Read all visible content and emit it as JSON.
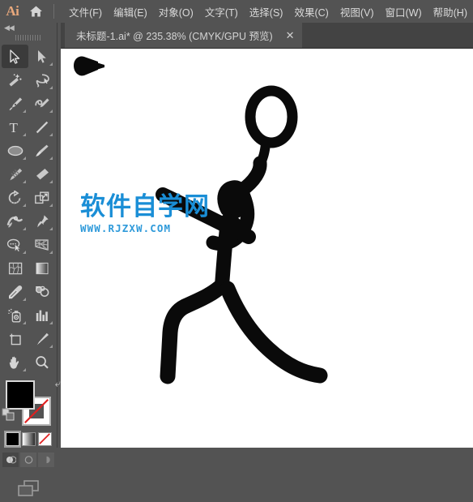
{
  "app": {
    "name": "Ai",
    "logo_color": "#e8a87c",
    "home_icon": "home-icon"
  },
  "menubar": {
    "items": [
      {
        "label": "文件(F)",
        "name": "menu-file"
      },
      {
        "label": "编辑(E)",
        "name": "menu-edit"
      },
      {
        "label": "对象(O)",
        "name": "menu-object"
      },
      {
        "label": "文字(T)",
        "name": "menu-type"
      },
      {
        "label": "选择(S)",
        "name": "menu-select"
      },
      {
        "label": "效果(C)",
        "name": "menu-effect"
      },
      {
        "label": "视图(V)",
        "name": "menu-view"
      },
      {
        "label": "窗口(W)",
        "name": "menu-window"
      },
      {
        "label": "帮助(H)",
        "name": "menu-help"
      }
    ]
  },
  "tabbar": {
    "tabs": [
      {
        "title": "未标题-1.ai* @ 235.38% (CMYK/GPU 预览)",
        "close_label": "✕",
        "active": true
      }
    ]
  },
  "toolpanel": {
    "collapse_label": "◀◀",
    "tools": [
      {
        "name": "selection-tool",
        "icon": "arrow-solid-outline",
        "active": true,
        "corner": false
      },
      {
        "name": "direct-selection-tool",
        "icon": "arrow-filled",
        "active": false,
        "corner": true
      },
      {
        "name": "magic-wand-tool",
        "icon": "magic-wand",
        "active": false,
        "corner": false
      },
      {
        "name": "lasso-tool",
        "icon": "lasso",
        "active": false,
        "corner": true
      },
      {
        "name": "pen-tool",
        "icon": "pen-nib",
        "active": false,
        "corner": true
      },
      {
        "name": "curvature-tool",
        "icon": "curvature",
        "active": false,
        "corner": true
      },
      {
        "name": "type-tool",
        "icon": "type-T",
        "active": false,
        "corner": true
      },
      {
        "name": "line-segment-tool",
        "icon": "line-diagonal",
        "active": false,
        "corner": true
      },
      {
        "name": "ellipse-tool",
        "icon": "ellipse",
        "active": false,
        "corner": true
      },
      {
        "name": "paintbrush-tool",
        "icon": "paintbrush",
        "active": false,
        "corner": true
      },
      {
        "name": "shaper-tool",
        "icon": "shaper-pencil",
        "active": false,
        "corner": true
      },
      {
        "name": "eraser-tool",
        "icon": "eraser",
        "active": false,
        "corner": true
      },
      {
        "name": "rotate-tool",
        "icon": "rotate",
        "active": false,
        "corner": true
      },
      {
        "name": "scale-tool",
        "icon": "scale-squares",
        "active": false,
        "corner": true
      },
      {
        "name": "width-tool",
        "icon": "width-warp",
        "active": false,
        "corner": true
      },
      {
        "name": "free-transform-tool",
        "icon": "push-pin",
        "active": false,
        "corner": true
      },
      {
        "name": "shape-builder-tool",
        "icon": "shape-builder",
        "active": false,
        "corner": true
      },
      {
        "name": "perspective-grid-tool",
        "icon": "perspective-grid",
        "active": false,
        "corner": true
      },
      {
        "name": "mesh-tool",
        "icon": "mesh",
        "active": false,
        "corner": false
      },
      {
        "name": "gradient-tool",
        "icon": "gradient-bar",
        "active": false,
        "corner": false
      },
      {
        "name": "eyedropper-tool",
        "icon": "eyedropper",
        "active": false,
        "corner": true
      },
      {
        "name": "blend-tool",
        "icon": "blend-shapes",
        "active": false,
        "corner": false
      },
      {
        "name": "symbol-sprayer-tool",
        "icon": "symbol-sprayer",
        "active": false,
        "corner": true
      },
      {
        "name": "column-graph-tool",
        "icon": "bar-chart",
        "active": false,
        "corner": true
      },
      {
        "name": "artboard-tool",
        "icon": "artboard",
        "active": false,
        "corner": false
      },
      {
        "name": "slice-tool",
        "icon": "slice-knife",
        "active": false,
        "corner": true
      },
      {
        "name": "hand-tool",
        "icon": "hand",
        "active": false,
        "corner": true
      },
      {
        "name": "zoom-tool",
        "icon": "magnifier",
        "active": false,
        "corner": false
      }
    ],
    "color": {
      "fill_color": "#000000",
      "stroke_color": "#ffffff",
      "stroke_is_none": true,
      "swap_icon": "swap-arrow-icon",
      "default_icon": "default-colors-icon",
      "modes": [
        {
          "name": "color-mode-swatch",
          "type": "solid",
          "selected": true
        },
        {
          "name": "gradient-mode-swatch",
          "type": "gradient",
          "selected": false
        },
        {
          "name": "none-mode-swatch",
          "type": "none",
          "selected": false
        }
      ],
      "draw_modes": [
        {
          "name": "draw-normal-button",
          "selected": true
        },
        {
          "name": "draw-behind-button",
          "selected": false
        },
        {
          "name": "draw-inside-button",
          "selected": false
        }
      ],
      "screen_mode": {
        "name": "screen-mode-button",
        "icon": "screen-mode-icon"
      }
    }
  },
  "canvas": {
    "background": "#ffffff",
    "artwork": {
      "name": "badminton-stick-figure",
      "stroke_color": "#0a0a0a",
      "description": "黑色简笔画羽毛球运动员与羽毛球"
    },
    "watermark": {
      "chinese": "软件自学网",
      "url": "WWW.RJZXW.COM",
      "color": "#1a8ed6"
    }
  }
}
